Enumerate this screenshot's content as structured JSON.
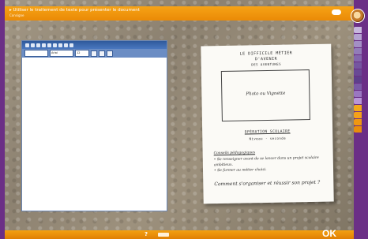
{
  "header": {
    "instruction": "▸ Utiliser le traitement de texte pour présenter le document",
    "subtitle": "Consigne"
  },
  "editor": {
    "font_value": "Arial",
    "size_value": "12"
  },
  "paper": {
    "title_line1": "LE DIFFICILE MÉTIER",
    "title_line2": "D'AVENIR",
    "title_line3": "DES AVENTURES",
    "box_text": "Photo ou Vignette",
    "info_line1": "OPÉRATION SCOLAIRE",
    "info_line2": "Niveau · seconde",
    "section_heading": "Conseils pédagogiques",
    "note1": "• Se renseigner avant de se lancer dans un projet scolaire",
    "note2": "   ambitieux.",
    "note3": "• Se former au métier choisi.",
    "question": "Comment s'organiser et réussir son projet ?"
  },
  "footer": {
    "help": "?",
    "ok": "OK"
  },
  "colors": {
    "accent": "#f29a0d",
    "frame": "#6b2f86"
  }
}
